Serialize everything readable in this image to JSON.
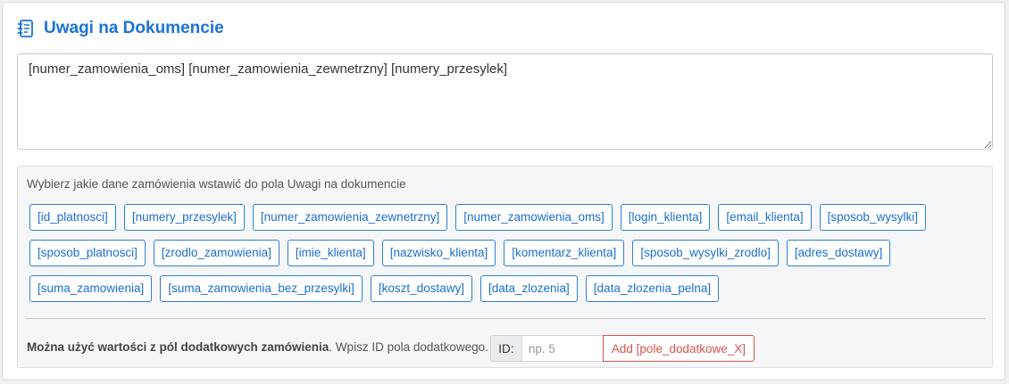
{
  "header": {
    "title": "Uwagi na Dokumencie",
    "icon": "notebook-icon",
    "accent_color": "#1a73d9"
  },
  "notes": {
    "value": "[numer_zamowienia_oms] [numer_zamowienia_zewnetrzny] [numery_przesylek]"
  },
  "panel": {
    "hint": "Wybierz jakie dane zamówienia wstawić do pola Uwagi na dokumencie",
    "tags": [
      "[id_platnosci]",
      "[numery_przesylek]",
      "[numer_zamowienia_zewnetrzny]",
      "[numer_zamowienia_oms]",
      "[login_klienta]",
      "[email_klienta]",
      "[sposob_wysylki]",
      "[sposob_platnosci]",
      "[zrodlo_zamowienia]",
      "[imie_klienta]",
      "[nazwisko_klienta]",
      "[komentarz_klienta]",
      "[sposob_wysylki_zrodlo]",
      "[adres_dostawy]",
      "[suma_zamowienia]",
      "[suma_zamowienia_bez_przesylki]",
      "[koszt_dostawy]",
      "[data_zlozenia]",
      "[data_zlozenia_pelna]"
    ],
    "tag_color": "#1a6fd1"
  },
  "extra_fields": {
    "bold_text": "Można użyć wartości z pól dodatkowych zamówienia",
    "rest_text": ". Wpisz ID pola dodatkowego.",
    "id_label": "ID:",
    "id_placeholder": "np. 5",
    "id_value": "",
    "add_button": "Add [pole_dodatkowe_X]",
    "add_button_color": "#d9534f"
  }
}
